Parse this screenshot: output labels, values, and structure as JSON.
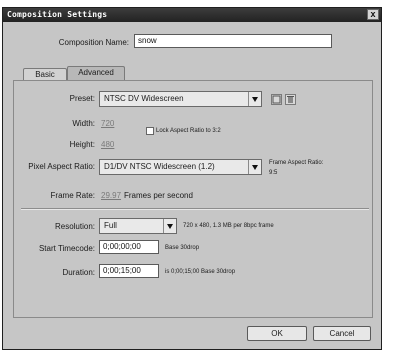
{
  "window": {
    "title": "Composition Settings",
    "close_label": "x"
  },
  "comp_name": {
    "label": "Composition Name:",
    "value": "snow"
  },
  "tabs": [
    {
      "label": "Basic",
      "active": true
    },
    {
      "label": "Advanced",
      "active": false
    }
  ],
  "preset": {
    "label": "Preset:",
    "value": "NTSC DV Widescreen"
  },
  "width": {
    "label": "Width:",
    "value": "720"
  },
  "height": {
    "label": "Height:",
    "value": "480"
  },
  "lock_aspect": {
    "label": "Lock Aspect Ratio to 3:2",
    "checked": false
  },
  "pixel_aspect": {
    "label": "Pixel Aspect Ratio:",
    "value": "D1/DV NTSC Widescreen (1.2)",
    "frame_aspect_label": "Frame Aspect Ratio:",
    "frame_aspect_value": "9:5"
  },
  "frame_rate": {
    "label": "Frame Rate:",
    "value": "29.97",
    "unit": "Frames per second"
  },
  "resolution": {
    "label": "Resolution:",
    "value": "Full",
    "info": "720 x 480, 1.3 MB per 8bpc frame"
  },
  "start_timecode": {
    "label": "Start Timecode:",
    "value": "0;00;00;00",
    "info": "Base 30drop"
  },
  "duration": {
    "label": "Duration:",
    "value": "0;00;15;00",
    "info": "is 0;00;15;00  Base 30drop"
  },
  "buttons": {
    "ok": "OK",
    "cancel": "Cancel"
  },
  "icons": {
    "save_preset": "save-icon",
    "delete_preset": "trash-icon"
  },
  "colors": {
    "dialog_bg": "#c6c6c6",
    "titlebar": "#2d2d2d"
  }
}
